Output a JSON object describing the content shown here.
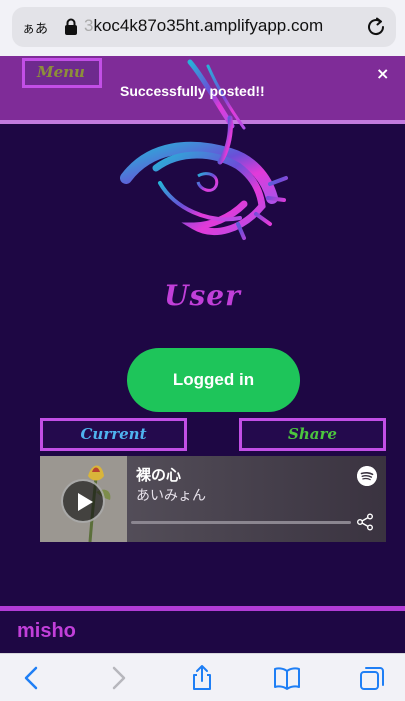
{
  "browser": {
    "aa_label": "ぁあ",
    "url_faded_prefix": "3",
    "url_text": "koc4k87o35ht.amplifyapp.com",
    "icons": [
      "lock-icon",
      "reload-icon",
      "back-icon",
      "forward-icon",
      "share-icon",
      "bookmarks-icon",
      "tabs-icon"
    ]
  },
  "header": {
    "menu_label": "Menu",
    "toast_message": "Successfully posted!!",
    "close_label": "×"
  },
  "profile": {
    "title": "User",
    "status_button": "Logged in"
  },
  "tabs": {
    "current_label": "Current",
    "share_label": "Share"
  },
  "spotify_card": {
    "track": "裸の心",
    "artist": "あいみょん",
    "progress": 0.0
  },
  "feed": {
    "username": "misho"
  },
  "colors": {
    "background": "#1e0744",
    "accent_purple": "#c13fd9",
    "banner": "#7f2c98",
    "spotify_green": "#1ec55a",
    "current_tab_text": "#4fb3ee",
    "share_tab_text": "#4cc63e"
  }
}
